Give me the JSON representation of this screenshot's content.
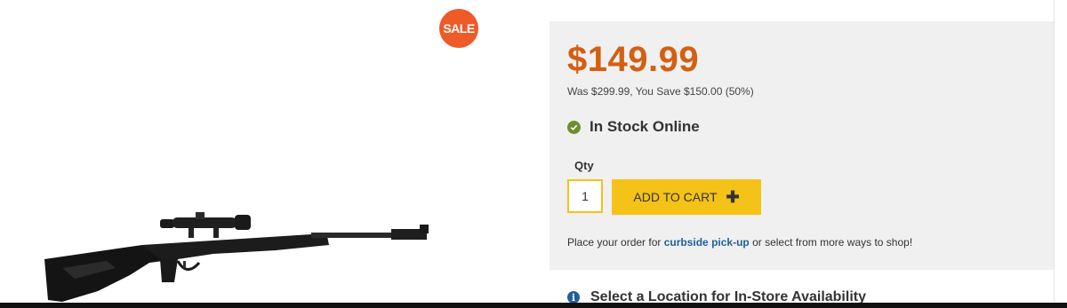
{
  "product": {
    "sale_badge": "SALE",
    "image_alt": "break barrel air rifle with scope"
  },
  "buy_box": {
    "price": "$149.99",
    "was_line": "Was $299.99, You Save $150.00 (50%)",
    "stock_status": "In Stock Online",
    "qty_label": "Qty",
    "qty_value": "1",
    "add_to_cart_label": "ADD TO CART",
    "add_to_cart_icon": "plus-icon",
    "pickup_prefix": "Place your order for ",
    "pickup_link": "curbside pick-up",
    "pickup_suffix": " or select from more ways to shop!",
    "location_label": "Select a Location for In-Store Availability",
    "location_icon": "info-icon"
  },
  "colors": {
    "price": "#d35f12",
    "sale_badge": "#ef5a29",
    "button": "#f5c218",
    "link": "#1f5f9e",
    "in_stock": "#6f8f2f",
    "panel_bg": "#f0f0f0"
  }
}
